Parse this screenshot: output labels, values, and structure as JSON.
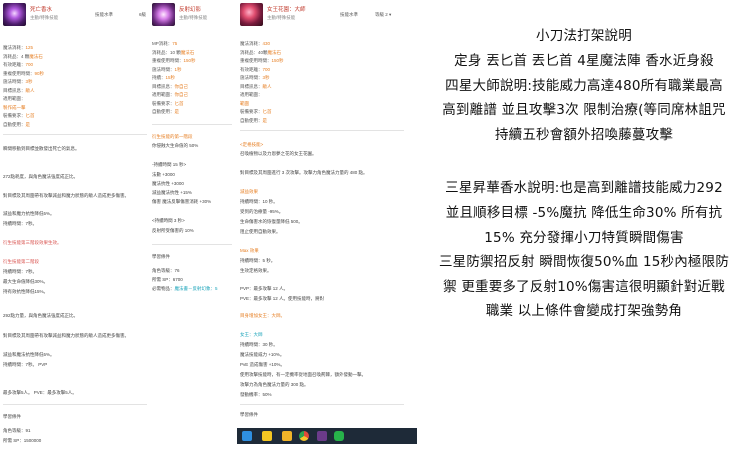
{
  "panels": [
    {
      "title": "死亡香水",
      "subtitle": "主動/特殊技能",
      "stat_label": "技能水準",
      "stat_value": "6級",
      "rows": [
        {
          "k": "魔法消耗：",
          "v": "125"
        },
        {
          "k": "消耗品：4 顆",
          "v": "魔法石"
        },
        {
          "k": "有效距離：",
          "v": "700"
        },
        {
          "k": "重複使用時間：",
          "v": "90秒"
        },
        {
          "k": "施法時間：",
          "v": "3秒"
        },
        {
          "k": "目標訊息：",
          "v": "敵人"
        },
        {
          "k": "適用範圍：",
          "v": ""
        },
        {
          "k": "",
          "v": "製作成一撃"
        },
        {
          "k": "裝備要求：",
          "v": "匕首"
        },
        {
          "k": "自動使用：",
          "v": "是"
        }
      ],
      "text1": "瞬間移動到目標並散發出死亡的氣息。",
      "text2": "272點耗度，與角色魔法強度成正比。",
      "text3": "對目標及其周圍帶有攻擊減益和魔力狀態的敵人造成更多傷害。",
      "text4": "減益和魔力抗性降低5%。",
      "text5": "持續時間：7秒。",
      "link1": "衍生技能第三階段效果生效。",
      "link2": "衍生技能第二階段",
      "text6": "持續時間：7秒。",
      "text7": "最大生命值降低30%。",
      "text8": "持有效抗性降低15%。",
      "text9": "292點力量，與角色魔法強度成正比。",
      "text10": "對目標及其周圍帶有攻擊減益和魔力狀態的敵人造成更多傷害。",
      "text11": "減益和魔法抗性降低5%。",
      "text12": "持續時間：7秒。 PVP",
      "text13": "最多攻擊5人。 PVE：最多攻擊5人。",
      "footer_title": "學習條件",
      "footer1": "角色等級：91",
      "footer2": "所需 SP：1500000"
    },
    {
      "title": "反射幻影",
      "subtitle": "主動/特殊技能",
      "rows": [
        {
          "k": "MP消耗：",
          "v": "75"
        },
        {
          "k": "消耗品：10 顆",
          "v": "魔法石"
        },
        {
          "k": "重複使用時間：",
          "v": "150秒"
        },
        {
          "k": "施法時間：",
          "v": "1秒"
        },
        {
          "k": "持續：",
          "v": "15秒"
        },
        {
          "k": "目標訊息：",
          "v": "你自己"
        },
        {
          "k": "適用範圍：",
          "v": "你自己"
        },
        {
          "k": "裝備要求：",
          "v": "匕首"
        },
        {
          "k": "自動使用：",
          "v": "是"
        }
      ],
      "orange1": "衍生技能的第一階段",
      "text1": "你侵蝕大生命值的 50%",
      "text2": "-持續時間 15 秒>",
      "text3": "法數 +3000",
      "text4": "魔法抗性 +3000",
      "text5": "減益魔法抗性 +15%",
      "text6": "傷害 魔法反擊傷害消耗 +30%",
      "text7": "<持續時間 3 秒>",
      "text8": "反射所受傷害的 10%",
      "footer_title": "學習條件",
      "footer1": "角色等級：76",
      "footer2": "所需 SP：6700",
      "footer3_k": "必需物品：",
      "footer3_v": "魔法書－反射幻象：5"
    },
    {
      "title": "女王花園：大師",
      "subtitle": "主動/特殊技能",
      "stat_label": "技能水準",
      "stat_value": "等級 2 ▾",
      "rows": [
        {
          "k": "魔法消耗：",
          "v": "430"
        },
        {
          "k": "消耗品：40顆",
          "v": "魔法石"
        },
        {
          "k": "重複使用時間：",
          "v": "150秒"
        },
        {
          "k": "有效距離：",
          "v": "700"
        },
        {
          "k": "施法時間：",
          "v": "3秒"
        },
        {
          "k": "目標訊息：",
          "v": "敵人"
        },
        {
          "k": "適用範圍：",
          "v": ""
        },
        {
          "k": "",
          "v": "範圍"
        },
        {
          "k": "裝備要求：",
          "v": "匕首"
        },
        {
          "k": "自動使用：",
          "v": "是"
        }
      ],
      "orange1": "<定格技能>",
      "text1": "召喚植物以及力恩夢之花的女王花園。",
      "text2": "對目標及其周圍進行 3 次攻擊。攻擊力角色魔法力量的 480 點。",
      "orange2": "減益效果",
      "text3": "持續時間：10 秒。",
      "text4": "受到的治療量 -95%。",
      "text5": "生命傷害水的恢復量降低 500。",
      "text6": "阻止使用自動效果。",
      "orange3": "Max 效果",
      "text7": "持續時間：5 秒。",
      "text8": "生效定格效果。",
      "text9": "PVP：最多攻擊 12 人。",
      "text10": "PVE：最多攻擊 12 人。使用技能時，將對",
      "orange4": "目身增加女王：大師。",
      "cyan1": "女王：大師",
      "text11": "持續時間：30 秒。",
      "text12": "魔法技能威力 +10%。",
      "text13": "PvE 造成傷害 +10%。",
      "text14": "使用攻擊技能時，有一定機率從地面召喚荊棘，額外發動一擊。",
      "text15": "攻擊力為角色魔法力量的 300 點。",
      "text16": "發動機率：50%",
      "footer_title": "學習條件"
    }
  ],
  "notes": {
    "title": "小刀法打架說明",
    "lines": [
      "定身 丟匕首 丟匕首 4星魔法陣 香水近身殺",
      "四星大師說明:技能威力高達480所有職業最高",
      "高到離譜 並且攻擊3次 限制治療(等同席林詛咒",
      "持續五秒會額外招喚藤蔓攻擊",
      "三星昇華香水說明:也是高到離譜技能威力292",
      "並且順移目標 -5%魔抗 降低生命30% 所有抗",
      "15% 充分發揮小刀特質瞬間傷害",
      "三星防禦招反射 瞬間恢復50%血 15秒內極限防",
      "禦 更重要多了反射10%傷害這很明顯針對近戰",
      "職業 以上條件會變成打架強勢角"
    ]
  },
  "taskbar": {
    "icons": [
      "edge-icon",
      "notes-icon",
      "folder-icon",
      "chrome-icon",
      "game-icon",
      "line-icon"
    ]
  }
}
